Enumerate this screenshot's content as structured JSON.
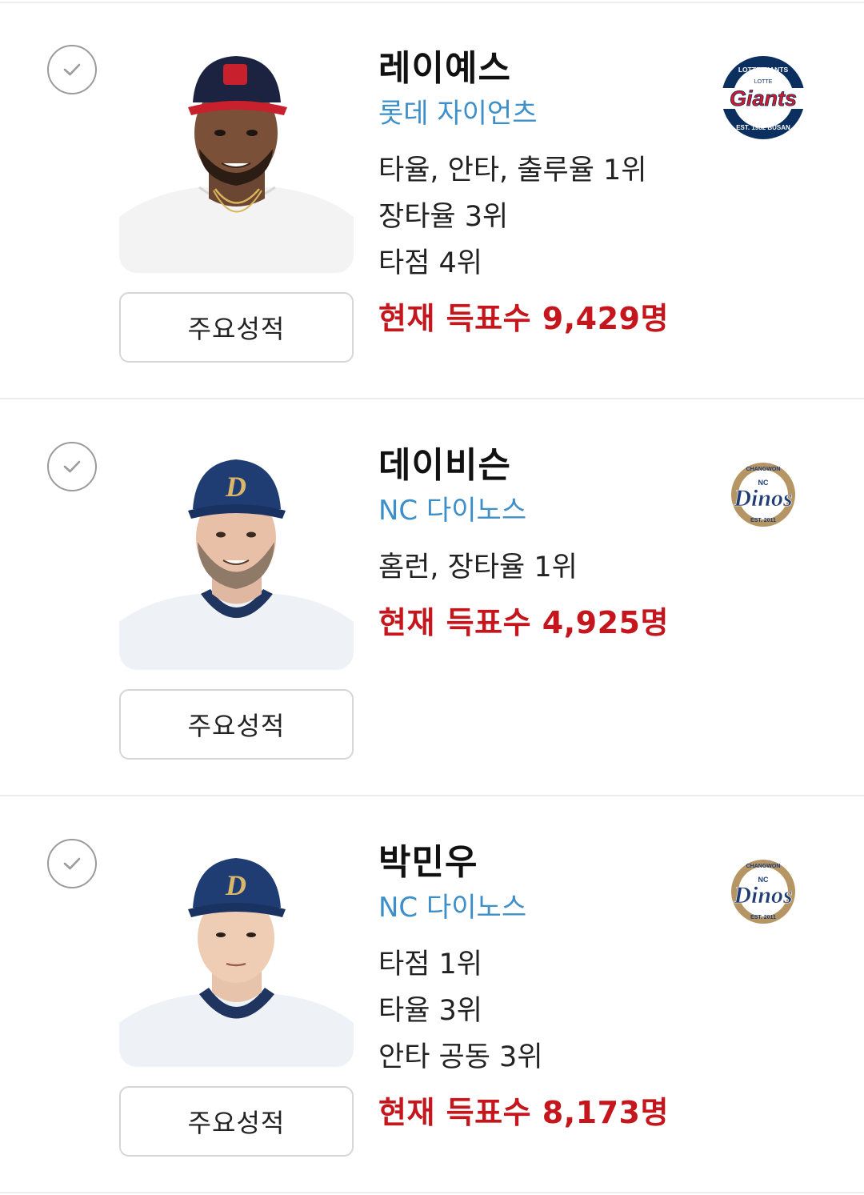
{
  "players": [
    {
      "name": "레이예스",
      "team": "롯데 자이언츠",
      "records": [
        "타율, 안타, 출루율 1위",
        "장타율 3위",
        "타점 4위"
      ],
      "votes": "현재 득표수 9,429명",
      "button_label": "주요성적",
      "photo_icon": "player-photo",
      "logo": {
        "name": "lotte-giants-logo",
        "ring_top": "LOTTE GIANTS",
        "small": "LOTTE",
        "wordmark": "Giants",
        "ring_bottom": "EST. 1982 BUSAN"
      }
    },
    {
      "name": "데이비슨",
      "team": "NC 다이노스",
      "records": [
        "홈런, 장타율 1위"
      ],
      "votes": "현재 득표수 4,925명",
      "button_label": "주요성적",
      "photo_icon": "player-photo",
      "logo": {
        "name": "nc-dinos-logo",
        "ring_top": "CHANGWON",
        "small": "NC",
        "wordmark": "Dinos",
        "ring_bottom": "EST. 2011"
      }
    },
    {
      "name": "박민우",
      "team": "NC 다이노스",
      "records": [
        "타점 1위",
        "타율 3위",
        "안타 공동 3위"
      ],
      "votes": "현재 득표수 8,173명",
      "button_label": "주요성적",
      "photo_icon": "player-photo",
      "logo": {
        "name": "nc-dinos-logo",
        "ring_top": "CHANGWON",
        "small": "NC",
        "wordmark": "Dinos",
        "ring_bottom": "EST. 2011"
      }
    }
  ],
  "colors": {
    "team_text": "#3d8fc9",
    "votes_text": "#c4161c",
    "giants_red": "#d7182a",
    "giants_navy": "#0b2f5f",
    "dinos_navy": "#1f3d73",
    "dinos_gold": "#b59563"
  }
}
